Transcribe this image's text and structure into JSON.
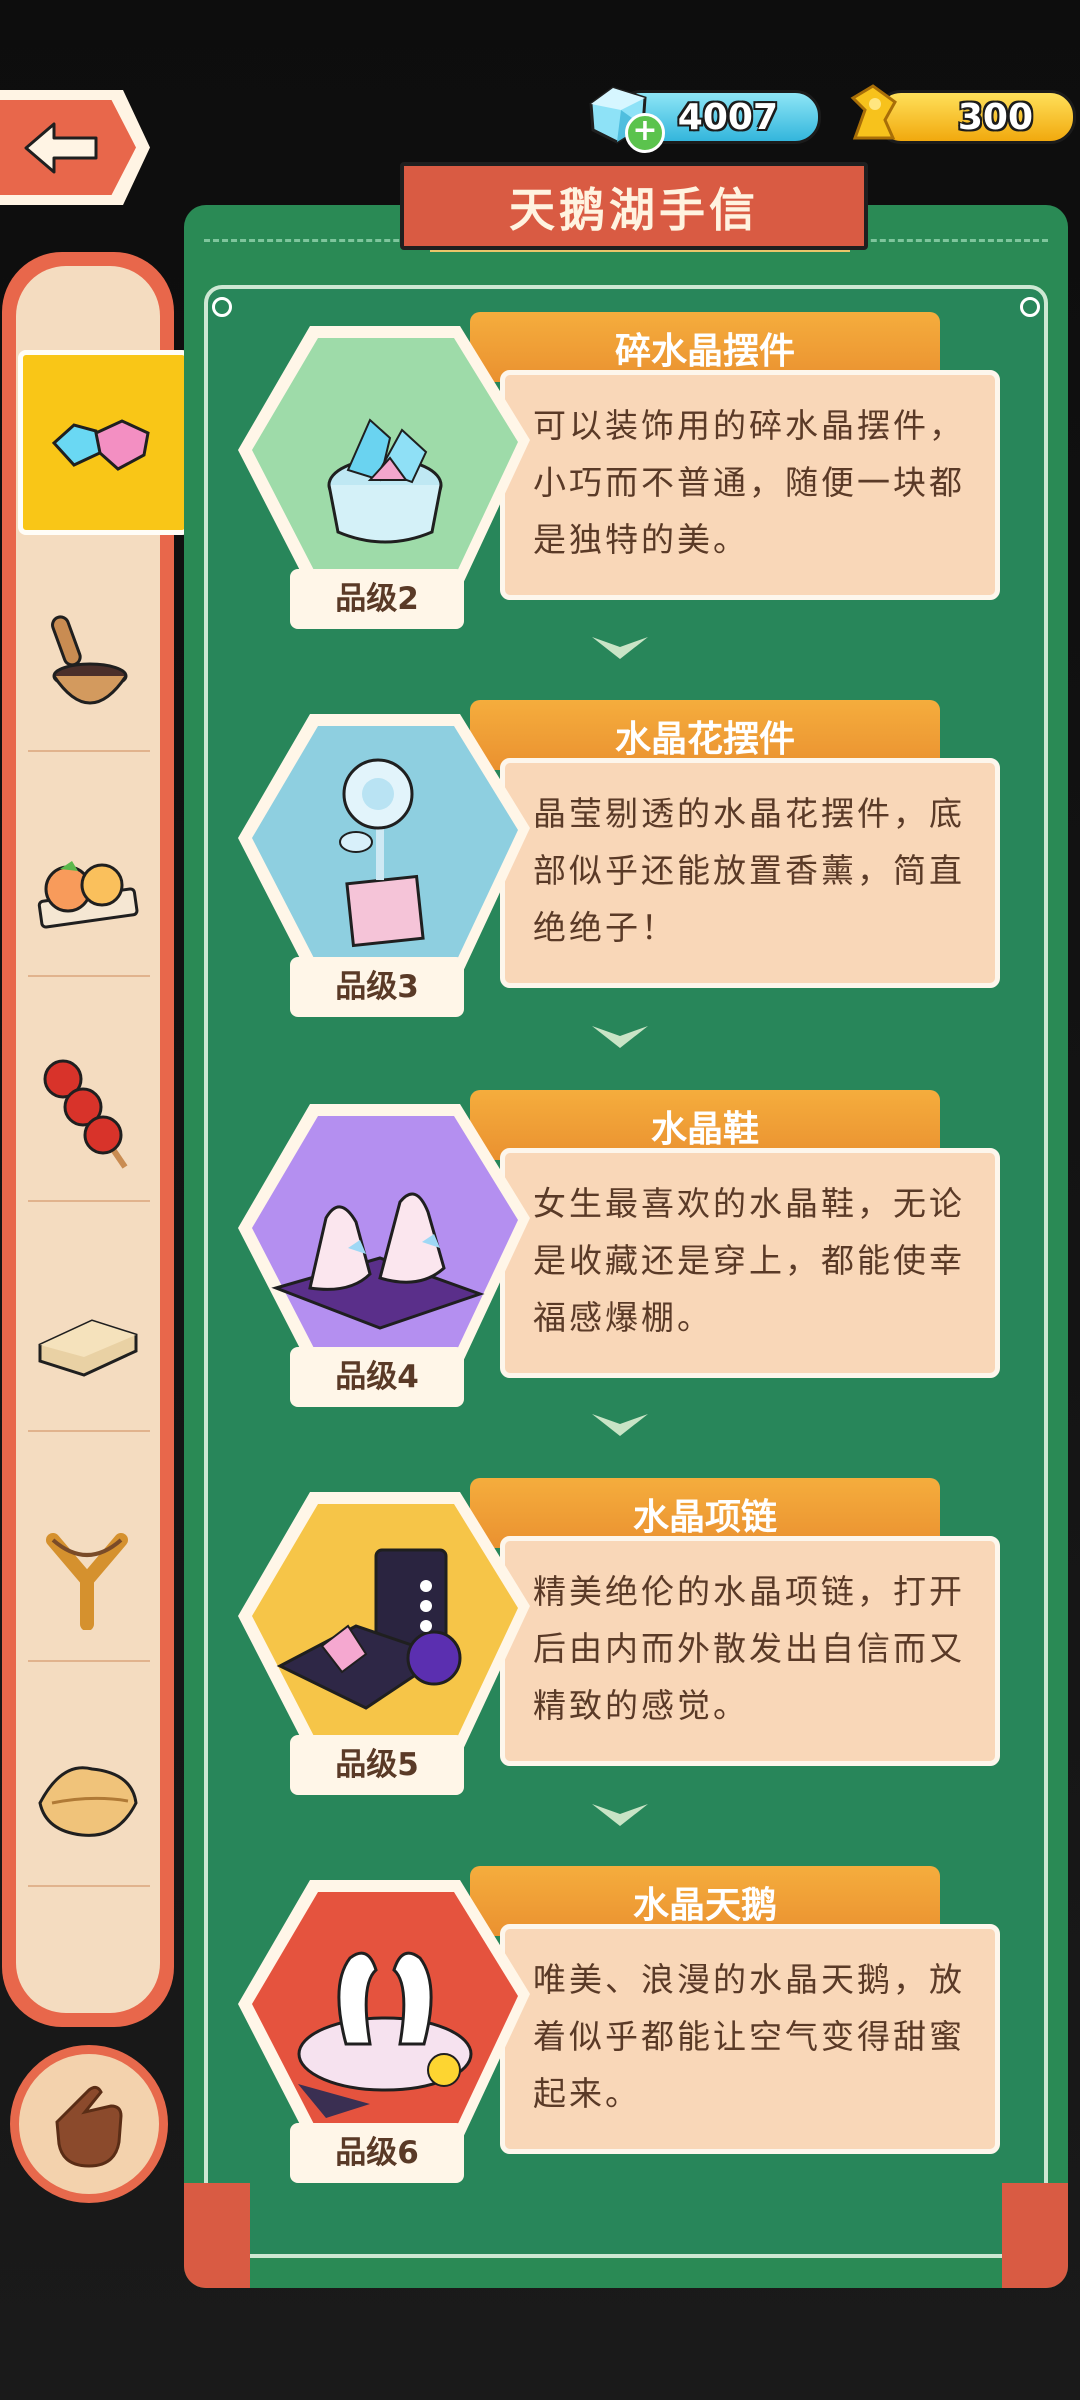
{
  "currency": {
    "gems": "4007",
    "gold": "300",
    "gem_icon": "blue-gem-icon",
    "gold_icon": "gold-coin-icon",
    "add_icon": "plus-icon"
  },
  "panel": {
    "title": "天鹅湖手信"
  },
  "items": [
    {
      "name": "碎水晶摆件",
      "desc": "可以装饰用的碎水晶摆件，小巧而不普通，随便一块都是独特的美。",
      "grade": "品级2",
      "hex_color": "#9edba9"
    },
    {
      "name": "水晶花摆件",
      "desc": "晶莹剔透的水晶花摆件，底部似乎还能放置香薰，简直绝绝子！",
      "grade": "品级3",
      "hex_color": "#8ecfe0"
    },
    {
      "name": "水晶鞋",
      "desc": "女生最喜欢的水晶鞋，无论是收藏还是穿上，都能使幸福感爆棚。",
      "grade": "品级4",
      "hex_color": "#b48ff0"
    },
    {
      "name": "水晶项链",
      "desc": "精美绝伦的水晶项链，打开后由内而外散发出自信而又精致的感觉。",
      "grade": "品级5",
      "hex_color": "#f6c548"
    },
    {
      "name": "水晶天鹅",
      "desc": "唯美、浪漫的水晶天鹅，放着似乎都能让空气变得甜蜜起来。",
      "grade": "品级6",
      "hex_color": "#e5533e"
    }
  ],
  "sidebar": {
    "items": [
      "crystal-hearts-icon",
      "mortar-pestle-icon",
      "peach-buns-icon",
      "candied-haws-icon",
      "biscuit-icon",
      "slingshot-icon",
      "leaf-cookie-icon"
    ],
    "bottom_button": "hand-pointer-icon"
  }
}
